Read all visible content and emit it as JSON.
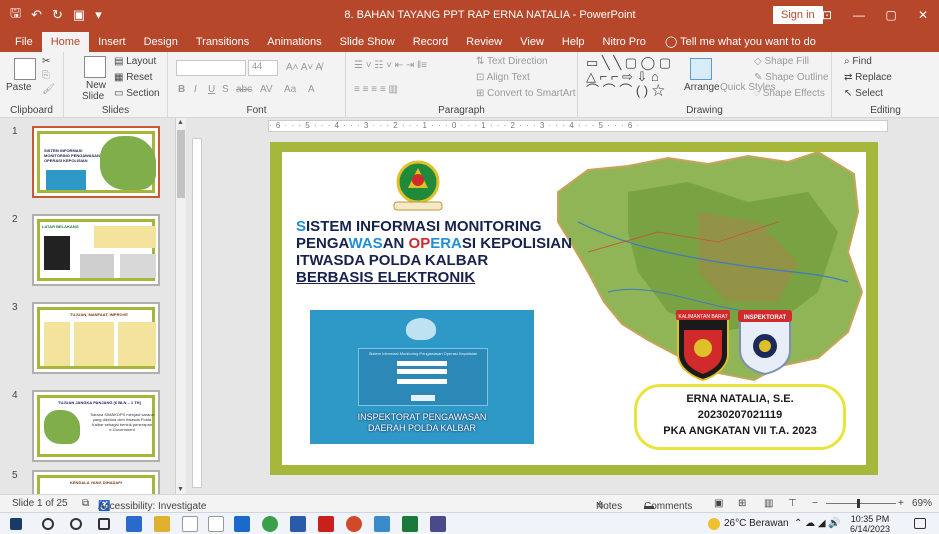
{
  "titlebar": {
    "doc_title": "8. BAHAN TAYANG PPT RAP ERNA NATALIA - PowerPoint",
    "signin_label": "Sign in",
    "qat": {
      "save": "🖫",
      "undo": "↶",
      "redo": "↻",
      "present": "▣",
      "more": "▾"
    },
    "controls": {
      "ribbon_opts": "⊡",
      "minimize": "—",
      "maximize": "▢",
      "close": "✕"
    }
  },
  "tabs": [
    "File",
    "Home",
    "Insert",
    "Design",
    "Transitions",
    "Animations",
    "Slide Show",
    "Record",
    "Review",
    "View",
    "Help",
    "Nitro Pro"
  ],
  "tell_me": "Tell me what you want to do",
  "ribbon": {
    "clipboard": {
      "label": "Clipboard",
      "paste": "Paste"
    },
    "slides": {
      "label": "Slides",
      "new_slide": "New",
      "new_slide2": "Slide",
      "layout": "Layout",
      "reset": "Reset",
      "section": "Section"
    },
    "font": {
      "label": "Font",
      "size": "44",
      "bold": "B",
      "italic": "I",
      "underline": "U",
      "strike": "S",
      "abc": "abc",
      "spacing": "AV",
      "case": "Aa",
      "color": "A"
    },
    "paragraph": {
      "label": "Paragraph",
      "text_direction": "Text Direction",
      "align_text": "Align Text",
      "smartart": "Convert to SmartArt"
    },
    "drawing": {
      "label": "Drawing",
      "arrange": "Arrange",
      "quick_styles": "Quick Styles",
      "shape_fill": "Shape Fill",
      "shape_outline": "Shape Outline",
      "shape_effects": "Shape Effects"
    },
    "editing": {
      "label": "Editing",
      "find": "Find",
      "replace": "Replace",
      "select": "Select"
    }
  },
  "thumbnails": {
    "items": [
      {
        "num": "1",
        "title": "SISTEM INFORMASI MONITORING PENGAWASAN OPERASI KEPOLISIAN"
      },
      {
        "num": "2",
        "title": "LATAR BELAKANG"
      },
      {
        "num": "3",
        "title": "TUJUAN, MANFAAT, IMPROVE"
      },
      {
        "num": "4",
        "title": "TUJUAN JANGKA PANJANG (6 BLN – 1 TH)",
        "body": "Sarana SIMAKOPS menjadi sarana yang dikelola oleh Itwasda Polda Kalbar sebagai bentuk penerapan e-Government"
      },
      {
        "num": "5",
        "title": "KENDALA YANG DIHADAPI"
      }
    ]
  },
  "ruler": "· 6 · · · 5 · · · 4 · · · 3 · · · 2 · · · 1 · · · 0 · · · 1 · · · 2 · · · 3 · · · 4 · · · 5 · · · 6 ·",
  "slide": {
    "title_parts": {
      "l1a": "S",
      "l1b": "ISTEM INFORMASI MONITORING",
      "l2a": "PENGA",
      "l2b": "WAS",
      "l2c": "AN ",
      "l2d": "OP",
      "l2e": "ERA",
      "l2f": "SI KEPOLISIAN",
      "l3": "ITWASDA POLDA KALBAR",
      "l4": "BERBASIS ELEKTRONIK"
    },
    "login_caption_1": "INSPEKTORAT PENGAWASAN",
    "login_caption_2": "DAERAH POLDA KALBAR",
    "login_header": "Sistem Informasi Monitoring Pengawasan Operasi Kepolisian",
    "badge_left": "KALIMANTAN BARAT",
    "badge_right": "INSPEKTORAT",
    "info_name": "ERNA NATALIA, S.E.",
    "info_id": "20230207021119",
    "info_program": "PKA ANGKATAN VII T.A. 2023"
  },
  "statusbar": {
    "slide_info": "Slide 1 of 25",
    "accessibility": "Accessibility: Investigate",
    "notes": "Notes",
    "comments": "Comments",
    "zoom": "69%"
  },
  "taskbar": {
    "weather": "26°C  Berawan",
    "time": "10:35 PM",
    "date": "6/14/2023"
  }
}
